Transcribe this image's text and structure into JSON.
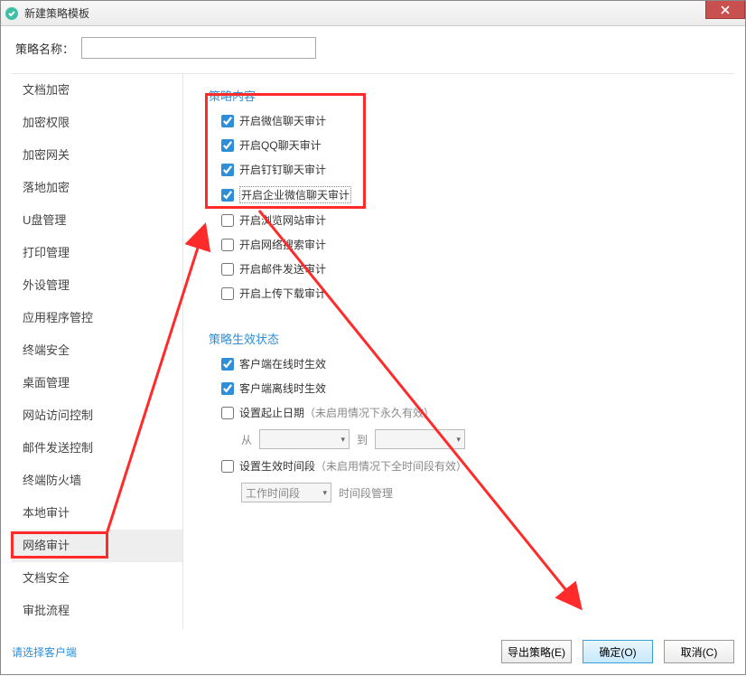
{
  "window": {
    "title": "新建策略模板"
  },
  "nameRow": {
    "label": "策略名称：",
    "value": ""
  },
  "sidebar": {
    "items": [
      {
        "label": "文档加密"
      },
      {
        "label": "加密权限"
      },
      {
        "label": "加密网关"
      },
      {
        "label": "落地加密"
      },
      {
        "label": "U盘管理"
      },
      {
        "label": "打印管理"
      },
      {
        "label": "外设管理"
      },
      {
        "label": "应用程序管控"
      },
      {
        "label": "终端安全"
      },
      {
        "label": "桌面管理"
      },
      {
        "label": "网站访问控制"
      },
      {
        "label": "邮件发送控制"
      },
      {
        "label": "终端防火墙"
      },
      {
        "label": "本地审计"
      },
      {
        "label": "网络审计",
        "selected": true
      },
      {
        "label": "文档安全"
      },
      {
        "label": "审批流程"
      }
    ]
  },
  "policyContent": {
    "title": "策略内容",
    "items": [
      {
        "label": "开启微信聊天审计",
        "checked": true
      },
      {
        "label": "开启QQ聊天审计",
        "checked": true
      },
      {
        "label": "开启钉钉聊天审计",
        "checked": true
      },
      {
        "label": "开启企业微信聊天审计",
        "checked": true,
        "dotted": true
      },
      {
        "label": "开启浏览网站审计",
        "checked": false
      },
      {
        "label": "开启网络搜索审计",
        "checked": false
      },
      {
        "label": "开启邮件发送审计",
        "checked": false
      },
      {
        "label": "开启上传下载审计",
        "checked": false
      }
    ]
  },
  "policyEffect": {
    "title": "策略生效状态",
    "clientOnline": {
      "label": "客户端在线时生效",
      "checked": true
    },
    "clientOffline": {
      "label": "客户端离线时生效",
      "checked": true
    },
    "dateRange": {
      "label": "设置起止日期",
      "hint": "（未启用情况下永久有效）",
      "checked": false,
      "fromLabel": "从",
      "toLabel": "到",
      "fromValue": "",
      "toValue": ""
    },
    "timeSlot": {
      "label": "设置生效时间段",
      "hint": "（未启用情况下全时间段有效）",
      "checked": false,
      "comboValue": "工作时间段",
      "manageLabel": "时间段管理"
    }
  },
  "footer": {
    "link": "请选择客户端",
    "exportBtn": "导出策略(E)",
    "okBtn": "确定(O)",
    "cancelBtn": "取消(C)"
  }
}
